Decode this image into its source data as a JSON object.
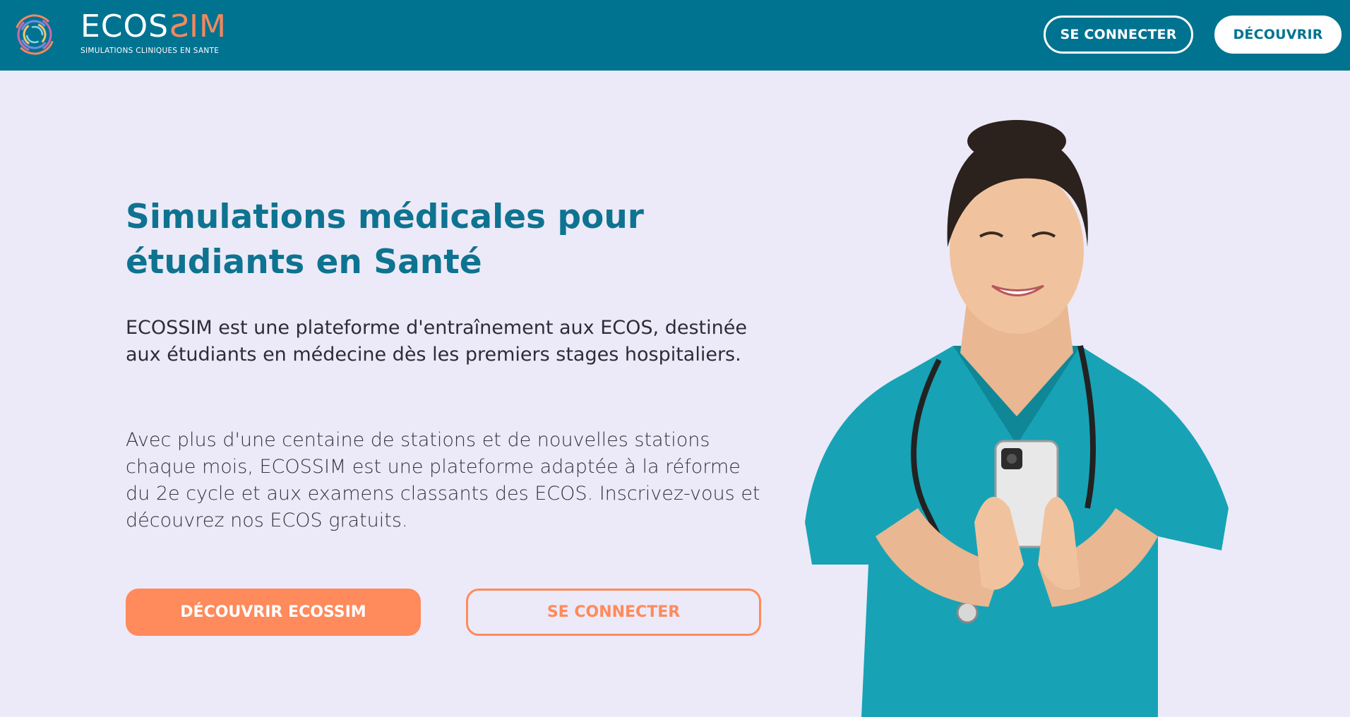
{
  "header": {
    "logo": {
      "word_part1": "ECOS",
      "word_part2": "S",
      "word_part3": "IM",
      "tagline": "SIMULATIONS CLINIQUES EN SANTE",
      "icon": "swirl-logo-icon"
    },
    "login_label": "SE CONNECTER",
    "discover_label": "DÉCOUVRIR"
  },
  "hero": {
    "title": "Simulations médicales pour étudiants en Santé",
    "lead": "ECOSSIM est une plateforme d'entraînement aux ECOS, destinée aux étudiants en médecine dès les premiers stages hospitaliers.",
    "body": "Avec plus d'une centaine de stations et de nouvelles stations chaque mois, ECOSSIM est une plateforme adaptée à la réforme du 2e cycle et aux examens classants des ECOS. Inscrivez-vous et découvrez nos ECOS gratuits.",
    "primary_cta": "DÉCOUVRIR ECOSSIM",
    "secondary_cta": "SE CONNECTER"
  },
  "colors": {
    "header_bg": "#007391",
    "page_bg": "#ECEAF8",
    "title": "#0E7390",
    "accent": "#FF8A5C",
    "scrubs": "#17A3B5"
  },
  "illustration": {
    "icon": "nurse-with-phone-illustration"
  }
}
